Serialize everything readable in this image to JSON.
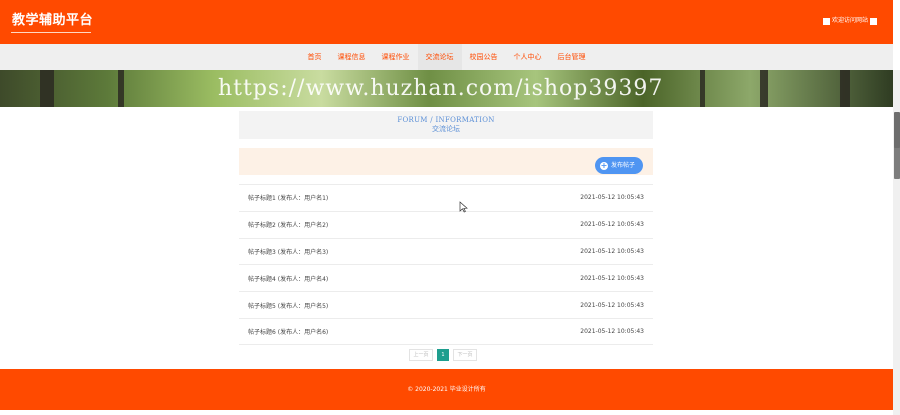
{
  "header": {
    "brand": "教学辅助平台",
    "welcome": "欢迎访问网站"
  },
  "nav": {
    "items": [
      "首页",
      "课程信息",
      "课程作业",
      "交流论坛",
      "校园公告",
      "个人中心",
      "后台管理"
    ],
    "active_index": 3
  },
  "banner": {
    "watermark": "https://www.huzhan.com/ishop39397"
  },
  "section": {
    "title_en": "FORUM / INFORMATION",
    "title_cn": "交流论坛"
  },
  "actions": {
    "post_label": "发布帖子"
  },
  "posts": [
    {
      "title": "帖子标题1 (发布人：用户名1)",
      "time": "2021-05-12 10:05:43"
    },
    {
      "title": "帖子标题2 (发布人：用户名2)",
      "time": "2021-05-12 10:05:43"
    },
    {
      "title": "帖子标题3 (发布人：用户名3)",
      "time": "2021-05-12 10:05:43"
    },
    {
      "title": "帖子标题4 (发布人：用户名4)",
      "time": "2021-05-12 10:05:43"
    },
    {
      "title": "帖子标题5 (发布人：用户名5)",
      "time": "2021-05-12 10:05:43"
    },
    {
      "title": "帖子标题6 (发布人：用户名6)",
      "time": "2021-05-12 10:05:43"
    }
  ],
  "pager": {
    "prev": "上一页",
    "current": "1",
    "next": "下一页"
  },
  "footer": {
    "copyright": "© 2020-2021 毕业设计所有"
  },
  "colors": {
    "brand": "#ff4a00",
    "accent_blue": "#4f95f2",
    "pager_active": "#1e9e8e"
  }
}
